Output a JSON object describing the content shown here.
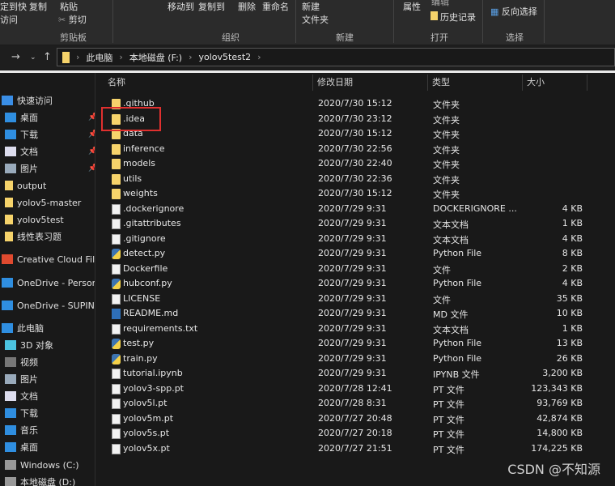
{
  "ribbon": {
    "pin_quick": "定到快\n访问",
    "pin_l1": "定到快",
    "pin_l2": "访问",
    "copy": "复制",
    "paste": "粘贴",
    "cut": "剪切",
    "move_to": "移动到",
    "copy_to": "复制到",
    "delete": "删除",
    "rename": "重命名",
    "new_folder_l1": "新建",
    "new_folder_l2": "文件夹",
    "properties": "属性",
    "edit": "编辑",
    "history": "历史记录",
    "invert_selection": "反向选择",
    "groups": [
      "剪贴板",
      "组织",
      "新建",
      "打开",
      "选择"
    ]
  },
  "breadcrumb": [
    "此电脑",
    "本地磁盘 (F:)",
    "yolov5test2"
  ],
  "sidebar": {
    "items": [
      {
        "label": "快速访问",
        "icon": "star-icon"
      },
      {
        "label": "桌面",
        "icon": "desktop-icon",
        "pinned": true
      },
      {
        "label": "下载",
        "icon": "download-icon",
        "pinned": true
      },
      {
        "label": "文档",
        "icon": "document-icon",
        "pinned": true
      },
      {
        "label": "图片",
        "icon": "picture-icon",
        "pinned": true
      },
      {
        "label": "output",
        "icon": "folder-icon"
      },
      {
        "label": "yolov5-master",
        "icon": "folder-icon"
      },
      {
        "label": "yolov5test",
        "icon": "folder-icon"
      },
      {
        "label": "线性表习题",
        "icon": "folder-icon"
      },
      {
        "label": "Creative Cloud Files",
        "icon": "creative-cloud-icon"
      },
      {
        "label": "OneDrive - Personal",
        "icon": "onedrive-icon"
      },
      {
        "label": "OneDrive - SUPINFO",
        "icon": "onedrive-icon"
      },
      {
        "label": "此电脑",
        "icon": "pc-icon"
      },
      {
        "label": "3D 对象",
        "icon": "3d-icon"
      },
      {
        "label": "视频",
        "icon": "video-icon"
      },
      {
        "label": "图片",
        "icon": "picture-icon"
      },
      {
        "label": "文档",
        "icon": "document-icon"
      },
      {
        "label": "下载",
        "icon": "download-icon"
      },
      {
        "label": "音乐",
        "icon": "music-icon"
      },
      {
        "label": "桌面",
        "icon": "desktop-icon"
      },
      {
        "label": "Windows (C:)",
        "icon": "drive-icon"
      },
      {
        "label": "本地磁盘 (D:)",
        "icon": "drive-icon"
      }
    ]
  },
  "columns": {
    "name": "名称",
    "date": "修改日期",
    "type": "类型",
    "size": "大小"
  },
  "files": [
    {
      "name": ".github",
      "date": "2020/7/30 15:12",
      "type": "文件夹",
      "size": "",
      "kind": "folder"
    },
    {
      "name": ".idea",
      "date": "2020/7/30 23:12",
      "type": "文件夹",
      "size": "",
      "kind": "folder"
    },
    {
      "name": "data",
      "date": "2020/7/30 15:12",
      "type": "文件夹",
      "size": "",
      "kind": "folder"
    },
    {
      "name": "inference",
      "date": "2020/7/30 22:56",
      "type": "文件夹",
      "size": "",
      "kind": "folder"
    },
    {
      "name": "models",
      "date": "2020/7/30 22:40",
      "type": "文件夹",
      "size": "",
      "kind": "folder"
    },
    {
      "name": "utils",
      "date": "2020/7/30 22:36",
      "type": "文件夹",
      "size": "",
      "kind": "folder"
    },
    {
      "name": "weights",
      "date": "2020/7/30 15:12",
      "type": "文件夹",
      "size": "",
      "kind": "folder"
    },
    {
      "name": ".dockerignore",
      "date": "2020/7/29 9:31",
      "type": "DOCKERIGNORE ...",
      "size": "4 KB",
      "kind": "file"
    },
    {
      "name": ".gitattributes",
      "date": "2020/7/29 9:31",
      "type": "文本文档",
      "size": "1 KB",
      "kind": "file"
    },
    {
      "name": ".gitignore",
      "date": "2020/7/29 9:31",
      "type": "文本文档",
      "size": "4 KB",
      "kind": "file"
    },
    {
      "name": "detect.py",
      "date": "2020/7/29 9:31",
      "type": "Python File",
      "size": "8 KB",
      "kind": "py"
    },
    {
      "name": "Dockerfile",
      "date": "2020/7/29 9:31",
      "type": "文件",
      "size": "2 KB",
      "kind": "file"
    },
    {
      "name": "hubconf.py",
      "date": "2020/7/29 9:31",
      "type": "Python File",
      "size": "4 KB",
      "kind": "py"
    },
    {
      "name": "LICENSE",
      "date": "2020/7/29 9:31",
      "type": "文件",
      "size": "35 KB",
      "kind": "file"
    },
    {
      "name": "README.md",
      "date": "2020/7/29 9:31",
      "type": "MD 文件",
      "size": "10 KB",
      "kind": "md"
    },
    {
      "name": "requirements.txt",
      "date": "2020/7/29 9:31",
      "type": "文本文档",
      "size": "1 KB",
      "kind": "file"
    },
    {
      "name": "test.py",
      "date": "2020/7/29 9:31",
      "type": "Python File",
      "size": "13 KB",
      "kind": "py"
    },
    {
      "name": "train.py",
      "date": "2020/7/29 9:31",
      "type": "Python File",
      "size": "26 KB",
      "kind": "py"
    },
    {
      "name": "tutorial.ipynb",
      "date": "2020/7/29 9:31",
      "type": "IPYNB 文件",
      "size": "3,200 KB",
      "kind": "file"
    },
    {
      "name": "yolov3-spp.pt",
      "date": "2020/7/28 12:41",
      "type": "PT 文件",
      "size": "123,343 KB",
      "kind": "file"
    },
    {
      "name": "yolov5l.pt",
      "date": "2020/7/28 8:31",
      "type": "PT 文件",
      "size": "93,769 KB",
      "kind": "file"
    },
    {
      "name": "yolov5m.pt",
      "date": "2020/7/27 20:48",
      "type": "PT 文件",
      "size": "42,874 KB",
      "kind": "file"
    },
    {
      "name": "yolov5s.pt",
      "date": "2020/7/27 20:18",
      "type": "PT 文件",
      "size": "14,800 KB",
      "kind": "file"
    },
    {
      "name": "yolov5x.pt",
      "date": "2020/7/27 21:51",
      "type": "PT 文件",
      "size": "174,225 KB",
      "kind": "file"
    }
  ],
  "watermark": "CSDN @不知源",
  "colors": {
    "highlight": "#e0302f",
    "folder": "#f6d36b"
  }
}
